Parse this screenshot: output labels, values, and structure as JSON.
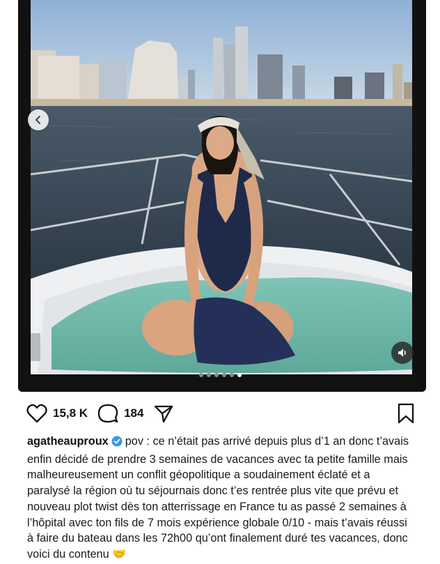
{
  "post": {
    "media": {
      "description_icon": "yacht-photo",
      "carousel": {
        "total": 6,
        "active_index": 5
      },
      "prev_icon": "chevron-left-icon",
      "mute_icon": "speaker-icon"
    },
    "actions": {
      "likes": "15,8 K",
      "comments": "184"
    },
    "caption": {
      "username": "agatheauproux",
      "text": "pov : ce n’était pas arrivé depuis plus d’1 an donc t’avais enfin décidé de prendre 3 semaines de vacances avec ta petite famille mais malheureusement un conflit géopolitique a soudainement éclaté et a paralysé la région où tu séjournais donc t’es rentrée plus vite que prévu et nouveau plot twist dès ton atterrissage en France tu as passé 2 semaines à l’hôpital avec ton fils de 7 mois expérience globale 0/10 - mais t’avais réussi à faire du bateau dans les 72h00 qu’ont finalement duré tes vacances, donc voici du contenu 🤝"
    }
  },
  "colors": {
    "accent_verified": "#3897f0",
    "frame": "#111111"
  }
}
